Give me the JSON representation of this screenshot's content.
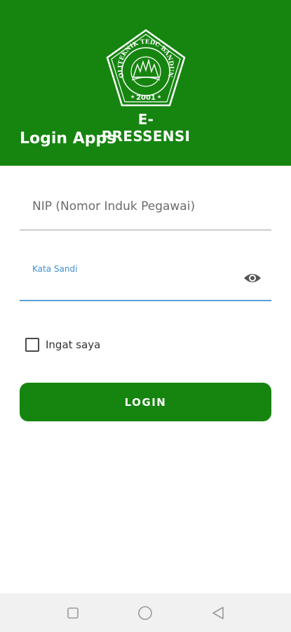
{
  "header": {
    "logo": {
      "icon": "pentagon-emblem-icon",
      "arc_text": "POLITEKNIK TEDC BANDUNG",
      "year": "2001"
    },
    "app_name": "E-PRESSENSI",
    "title": "Login Apps"
  },
  "form": {
    "nip_placeholder": "NIP (Nomor Induk Pegawai)",
    "password_label": "Kata Sandi",
    "password_toggle_icon": "eye-icon",
    "remember_label": "Ingat saya",
    "remember_checked": false,
    "login_label": "LOGIN"
  },
  "navbar": {
    "recent_icon": "square-icon",
    "home_icon": "circle-icon",
    "back_icon": "triangle-back-icon"
  },
  "colors": {
    "primary_green": "#168510",
    "focus_blue": "#3f8fd2",
    "navbar_bg": "#f1f1f1"
  }
}
